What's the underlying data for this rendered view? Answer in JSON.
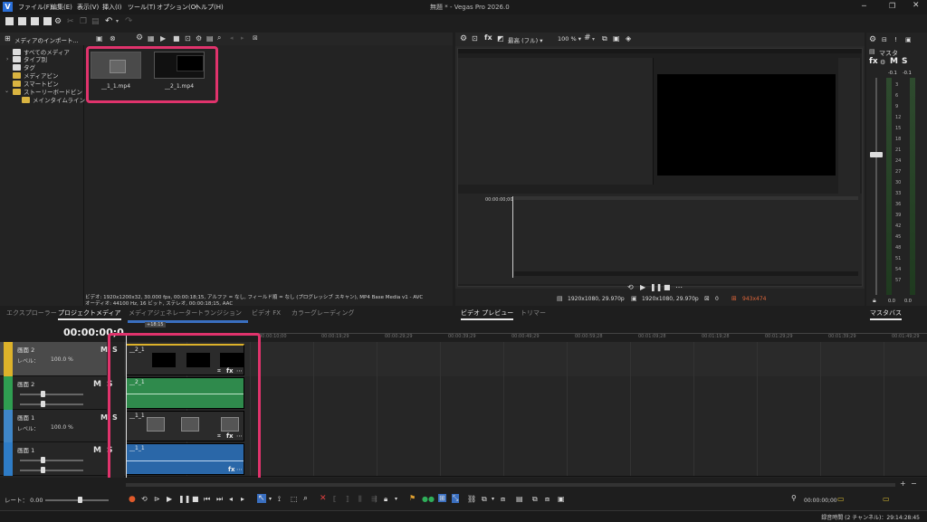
{
  "menu": {
    "items": [
      "ファイル(F)",
      "編集(E)",
      "表示(V)",
      "挿入(I)",
      "ツール(T)",
      "オプション(O)",
      "ヘルプ(H)"
    ],
    "title": "無題 * - Vegas Pro 2026.0"
  },
  "explorer": {
    "header_label": "メディアのインポート...",
    "tree": [
      "すべてのメディア",
      "タイプ別",
      "タグ",
      "メディアビン",
      "スマートビン",
      "ストーリーボードビン",
      "メインタイムライン"
    ]
  },
  "media": {
    "thumbs": [
      {
        "name": "__1_1.mp4"
      },
      {
        "name": "__2_1.mp4"
      }
    ],
    "info_line1": "ビデオ: 1920x1200x32, 30.000 fps, 00:00:18;15, アルファ = なし, フィールド順 = なし (プログレッシブ スキャン), MP4 Base Media v1 - AVC",
    "info_line2": "オーディオ: 44100 Hz, 16 ビット, ステレオ, 00:00:18;15, AAC"
  },
  "tabs_left": [
    "エクスプローラー",
    "プロジェクトメディア",
    "メディアジェネレーター",
    "トランジション",
    "ビデオ FX",
    "カラーグレーディング"
  ],
  "preview": {
    "quality": "最高 (フル)",
    "zoom": "100 %",
    "project_label": "1920x1080, 29.970p",
    "preview_label": "1920x1080, 29.970p",
    "frame": "0",
    "display": "943x474",
    "mini_timecode": "00:00:00;00"
  },
  "tabs_mid": [
    "ビデオ プレビュー",
    "トリマー"
  ],
  "master": {
    "title": "マスタ",
    "labels": [
      "fx",
      "M",
      "S"
    ],
    "peak_left": "-0.1",
    "peak_right": "-0.1",
    "scale": [
      "3",
      "6",
      "9",
      "12",
      "15",
      "18",
      "21",
      "24",
      "27",
      "30",
      "33",
      "36",
      "39",
      "42",
      "45",
      "48",
      "51",
      "54",
      "57"
    ],
    "bottom_left": "0.0",
    "bottom_right": "0.0",
    "tab": "マスタバス"
  },
  "timeline": {
    "timecode": "00:00:00;00",
    "ruler_marker": "+18:15",
    "ruler": [
      "00:00:10;00",
      "00:00:19;29",
      "00:00:29;29",
      "00:00:39;29",
      "00:00:49;29",
      "00:00:59;28",
      "00:01:09;28",
      "00:01:19;28",
      "00:01:29;29",
      "00:01:39;29",
      "00:01:49;29",
      "00:01:59;28"
    ],
    "tracks": [
      {
        "name": "画面 2",
        "level_label": "レベル：",
        "level": "100.0 %",
        "type": "video"
      },
      {
        "name": "画面 2",
        "type": "audio"
      },
      {
        "name": "画面 1",
        "level_label": "レベル：",
        "level": "100.0 %",
        "type": "video"
      },
      {
        "name": "画面 1",
        "type": "audio"
      }
    ],
    "clips": [
      "__2_1",
      "__2_1",
      "__1_1",
      "__1_1"
    ],
    "rate_label": "レート： 0.00",
    "end_timecode": "00:00:00;00"
  },
  "status": {
    "text": "録音時間 (2 チャンネル)：29:14:28:45"
  },
  "colors": {
    "highlight": "#e0336c",
    "video_track": "#ddb22a",
    "audio_track": "#2f9e51",
    "video_track_2": "#3f86c8",
    "audio_track_2": "#2e7cc7",
    "audio_clip": "#2f8a4c",
    "audio_clip_2": "#2a67a8"
  }
}
